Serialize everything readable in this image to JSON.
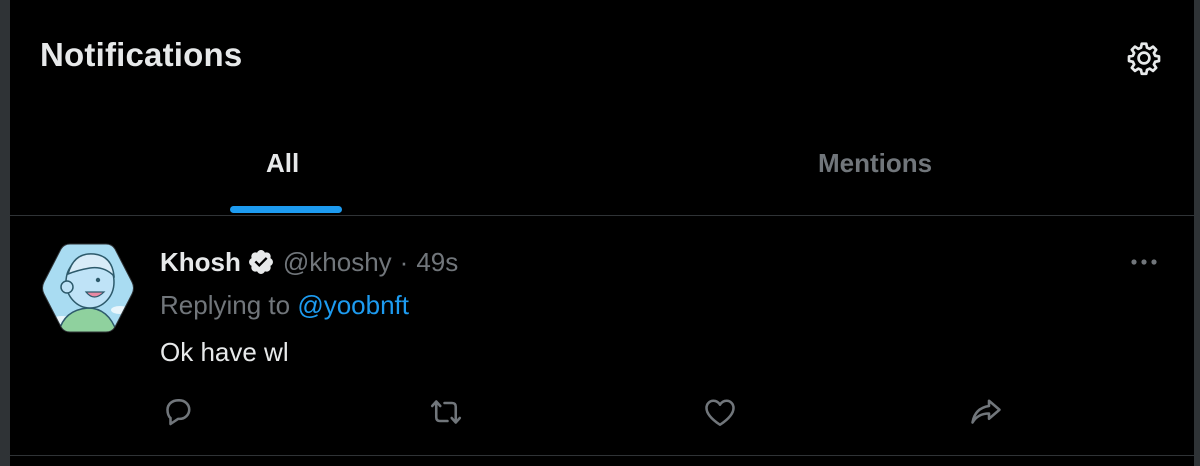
{
  "header": {
    "title": "Notifications",
    "settings_icon": "gear-icon"
  },
  "tabs": [
    {
      "label": "All",
      "active": true
    },
    {
      "label": "Mentions",
      "active": false
    }
  ],
  "tweet": {
    "author_name": "Khosh",
    "verified_icon": "verified-badge-icon",
    "handle": "@khoshy",
    "separator": "·",
    "time": "49s",
    "replying_prefix": "Replying to",
    "replying_to": "@yoobnft",
    "text": "Ok have wl",
    "more_icon": "more-dots-icon",
    "actions": [
      "reply-icon",
      "retweet-icon",
      "like-icon",
      "share-icon"
    ]
  },
  "colors": {
    "background": "#000000",
    "border": "#2f3336",
    "text_primary": "#e7e9ea",
    "text_secondary": "#71767b",
    "accent": "#1d9bf0"
  }
}
